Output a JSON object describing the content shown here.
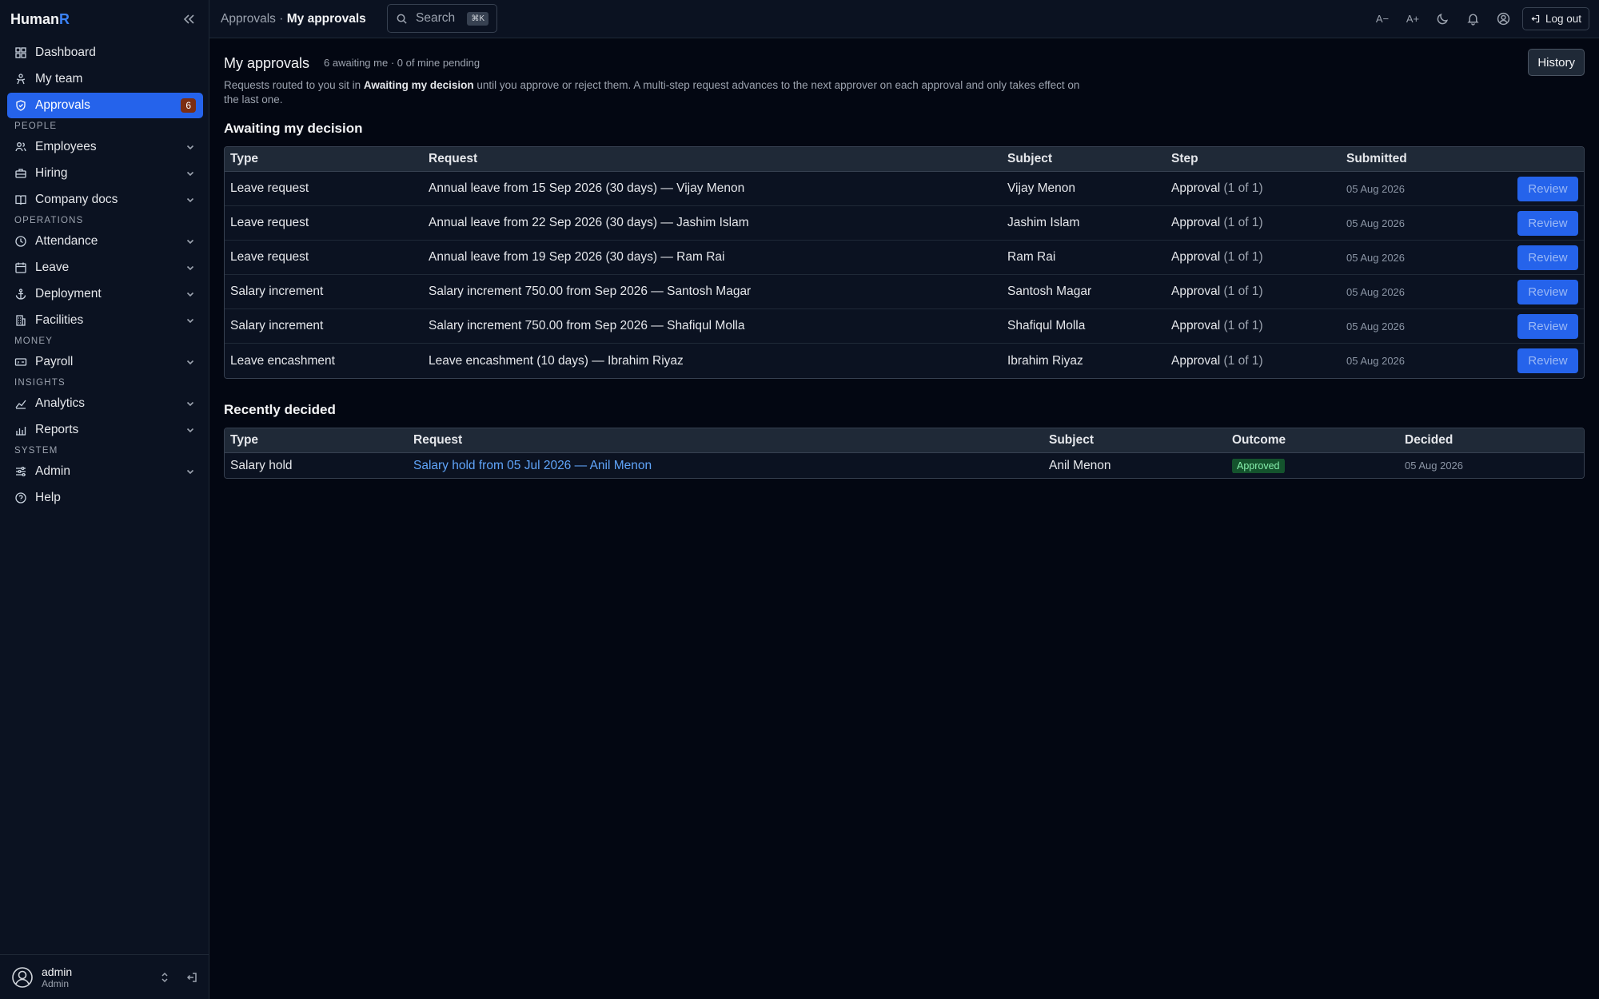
{
  "brand": {
    "name_main": "Human",
    "name_accent": "R"
  },
  "sidebar": {
    "items_top": [
      {
        "icon": "grid-icon",
        "label": "Dashboard"
      },
      {
        "icon": "team-icon",
        "label": "My team"
      },
      {
        "icon": "shield-check-icon",
        "label": "Approvals",
        "badge": "6",
        "active": true
      }
    ],
    "sections": [
      {
        "title": "PEOPLE",
        "items": [
          {
            "icon": "users-icon",
            "label": "Employees"
          },
          {
            "icon": "briefcase-icon",
            "label": "Hiring"
          },
          {
            "icon": "book-icon",
            "label": "Company docs"
          }
        ]
      },
      {
        "title": "OPERATIONS",
        "items": [
          {
            "icon": "clock-icon",
            "label": "Attendance"
          },
          {
            "icon": "calendar-icon",
            "label": "Leave"
          },
          {
            "icon": "anchor-icon",
            "label": "Deployment"
          },
          {
            "icon": "building-icon",
            "label": "Facilities"
          }
        ]
      },
      {
        "title": "MONEY",
        "items": [
          {
            "icon": "payroll-icon",
            "label": "Payroll"
          }
        ]
      },
      {
        "title": "INSIGHTS",
        "items": [
          {
            "icon": "chart-line-icon",
            "label": "Analytics"
          },
          {
            "icon": "chart-bar-icon",
            "label": "Reports"
          }
        ]
      },
      {
        "title": "SYSTEM",
        "items": [
          {
            "icon": "sliders-icon",
            "label": "Admin"
          }
        ]
      }
    ],
    "help": {
      "icon": "help-icon",
      "label": "Help"
    },
    "user": {
      "name": "admin",
      "role": "Admin"
    }
  },
  "topbar": {
    "breadcrumb_parent": "Approvals",
    "breadcrumb_sep": "·",
    "breadcrumb_current": "My approvals",
    "search_placeholder": "Search",
    "search_shortcut": "⌘K",
    "font_smaller": "A−",
    "font_larger": "A+",
    "logout": "Log out"
  },
  "page": {
    "title": "My approvals",
    "meta": "6 awaiting me · 0 of mine pending",
    "history_button": "History",
    "intro_before": "Requests routed to you sit in ",
    "intro_bold": "Awaiting my decision",
    "intro_after": " until you approve or reject them. A multi-step request advances to the next approver on each approval and only takes effect on the last one."
  },
  "awaiting": {
    "title": "Awaiting my decision",
    "columns": [
      "Type",
      "Request",
      "Subject",
      "Step",
      "Submitted"
    ],
    "action_label": "Review",
    "rows": [
      {
        "type": "Leave request",
        "request": "Annual leave from 15 Sep 2026 (30 days) — Vijay Menon",
        "subject": "Vijay Menon",
        "step": "Approval",
        "step_count": "(1 of 1)",
        "submitted": "05 Aug 2026"
      },
      {
        "type": "Leave request",
        "request": "Annual leave from 22 Sep 2026 (30 days) — Jashim Islam",
        "subject": "Jashim Islam",
        "step": "Approval",
        "step_count": "(1 of 1)",
        "submitted": "05 Aug 2026"
      },
      {
        "type": "Leave request",
        "request": "Annual leave from 19 Sep 2026 (30 days) — Ram Rai",
        "subject": "Ram Rai",
        "step": "Approval",
        "step_count": "(1 of 1)",
        "submitted": "05 Aug 2026"
      },
      {
        "type": "Salary increment",
        "request": "Salary increment 750.00 from Sep 2026 — Santosh Magar",
        "subject": "Santosh Magar",
        "step": "Approval",
        "step_count": "(1 of 1)",
        "submitted": "05 Aug 2026"
      },
      {
        "type": "Salary increment",
        "request": "Salary increment 750.00 from Sep 2026 — Shafiqul Molla",
        "subject": "Shafiqul Molla",
        "step": "Approval",
        "step_count": "(1 of 1)",
        "submitted": "05 Aug 2026"
      },
      {
        "type": "Leave encashment",
        "request": "Leave encashment (10 days) — Ibrahim Riyaz",
        "subject": "Ibrahim Riyaz",
        "step": "Approval",
        "step_count": "(1 of 1)",
        "submitted": "05 Aug 2026"
      }
    ]
  },
  "decided": {
    "title": "Recently decided",
    "columns": [
      "Type",
      "Request",
      "Subject",
      "Outcome",
      "Decided"
    ],
    "rows": [
      {
        "type": "Salary hold",
        "request": "Salary hold from 05 Jul 2026 — Anil Menon",
        "subject": "Anil Menon",
        "outcome": "Approved",
        "decided": "05 Aug 2026"
      }
    ]
  },
  "colors": {
    "accent": "#2563eb",
    "background": "#030712",
    "sidebar": "#0b1221",
    "badge": "#7c2d12",
    "success": "#14532d"
  }
}
